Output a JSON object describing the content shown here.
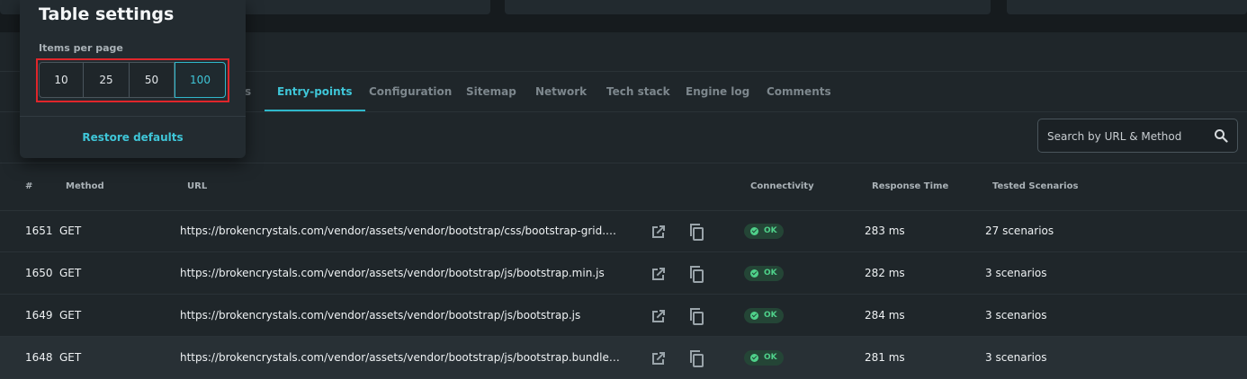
{
  "tabs": [
    {
      "label": "s",
      "active": false
    },
    {
      "label": "Entry-points",
      "active": true
    },
    {
      "label": "Configuration",
      "active": false
    },
    {
      "label": "Sitemap",
      "active": false
    },
    {
      "label": "Network",
      "active": false
    },
    {
      "label": "Tech stack",
      "active": false
    },
    {
      "label": "Engine log",
      "active": false
    },
    {
      "label": "Comments",
      "active": false
    }
  ],
  "search": {
    "placeholder": "Search by URL & Method",
    "icon": "search-icon"
  },
  "table": {
    "headers": {
      "num": "#",
      "method": "Method",
      "url": "URL",
      "connectivity": "Connectivity",
      "response_time": "Response Time",
      "tested_scenarios": "Tested Scenarios"
    },
    "rows": [
      {
        "num": "1651",
        "method": "GET",
        "url": "https://brokencrystals.com/vendor/assets/vendor/bootstrap/css/bootstrap-grid.css....",
        "status": "OK",
        "response_time": "283 ms",
        "scenarios": "27 scenarios"
      },
      {
        "num": "1650",
        "method": "GET",
        "url": "https://brokencrystals.com/vendor/assets/vendor/bootstrap/js/bootstrap.min.js",
        "status": "OK",
        "response_time": "282 ms",
        "scenarios": "3 scenarios"
      },
      {
        "num": "1649",
        "method": "GET",
        "url": "https://brokencrystals.com/vendor/assets/vendor/bootstrap/js/bootstrap.js",
        "status": "OK",
        "response_time": "284 ms",
        "scenarios": "3 scenarios"
      },
      {
        "num": "1648",
        "method": "GET",
        "url": "https://brokencrystals.com/vendor/assets/vendor/bootstrap/js/bootstrap.bundle.mi...",
        "status": "OK",
        "response_time": "281 ms",
        "scenarios": "3 scenarios"
      }
    ]
  },
  "table_settings": {
    "title": "Table settings",
    "items_per_page_label": "Items per page",
    "options": [
      "10",
      "25",
      "50",
      "100"
    ],
    "selected": "100",
    "restore_label": "Restore defaults"
  },
  "colors": {
    "accent": "#2fb8cb",
    "ok_green": "#4fd18a",
    "highlight_red": "#e0262b",
    "background": "#1f262a"
  }
}
